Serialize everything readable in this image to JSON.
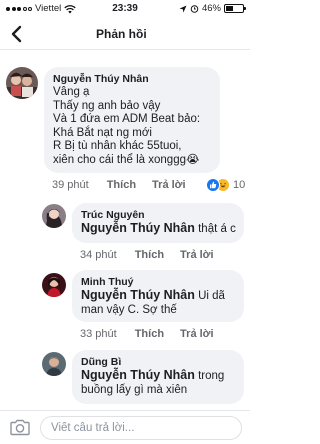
{
  "status_bar": {
    "carrier": "Viettel",
    "time": "23:39",
    "battery_percent": "46%",
    "battery_level": 0.46
  },
  "header": {
    "title": "Phản hồi"
  },
  "comments": [
    {
      "author": "Nguyễn Thúy Nhân",
      "lines": [
        "Vâng ạ",
        "Thấy ng anh bảo vậy",
        "Và 1 đứa em ADM Beat bảo:",
        "Khá Bắt nạt ng mới",
        "R Bị tù nhân khác 55tuoi,",
        "xiên cho cái thể là xonggg😭"
      ],
      "time": "39 phút",
      "like": "Thích",
      "reply": "Trả lời",
      "reaction_count": "10"
    },
    {
      "author": "Trúc Nguyên",
      "mention": "Nguyễn Thúy Nhân",
      "text_after_mention": "thật á c",
      "time": "34 phút",
      "like": "Thích",
      "reply": "Trả lời"
    },
    {
      "author": "Minh Thuý",
      "mention": "Nguyễn Thúy Nhân",
      "text_after_mention": "Ui dã",
      "line2": "man vậy C. Sợ thế",
      "time": "33 phút",
      "like": "Thích",
      "reply": "Trả lời"
    },
    {
      "author": "Dũng Bì",
      "mention": "Nguyễn Thúy Nhân",
      "text_after_mention": "trong",
      "line2": "buồng lấy gì mà xiên"
    }
  ],
  "composer": {
    "placeholder": "Viết câu trả lời..."
  },
  "colors": {
    "bubble": "#f0f2f5",
    "meta_text": "#65676b",
    "like_blue": "#1877f2",
    "haha_yellow": "#f7b928"
  }
}
